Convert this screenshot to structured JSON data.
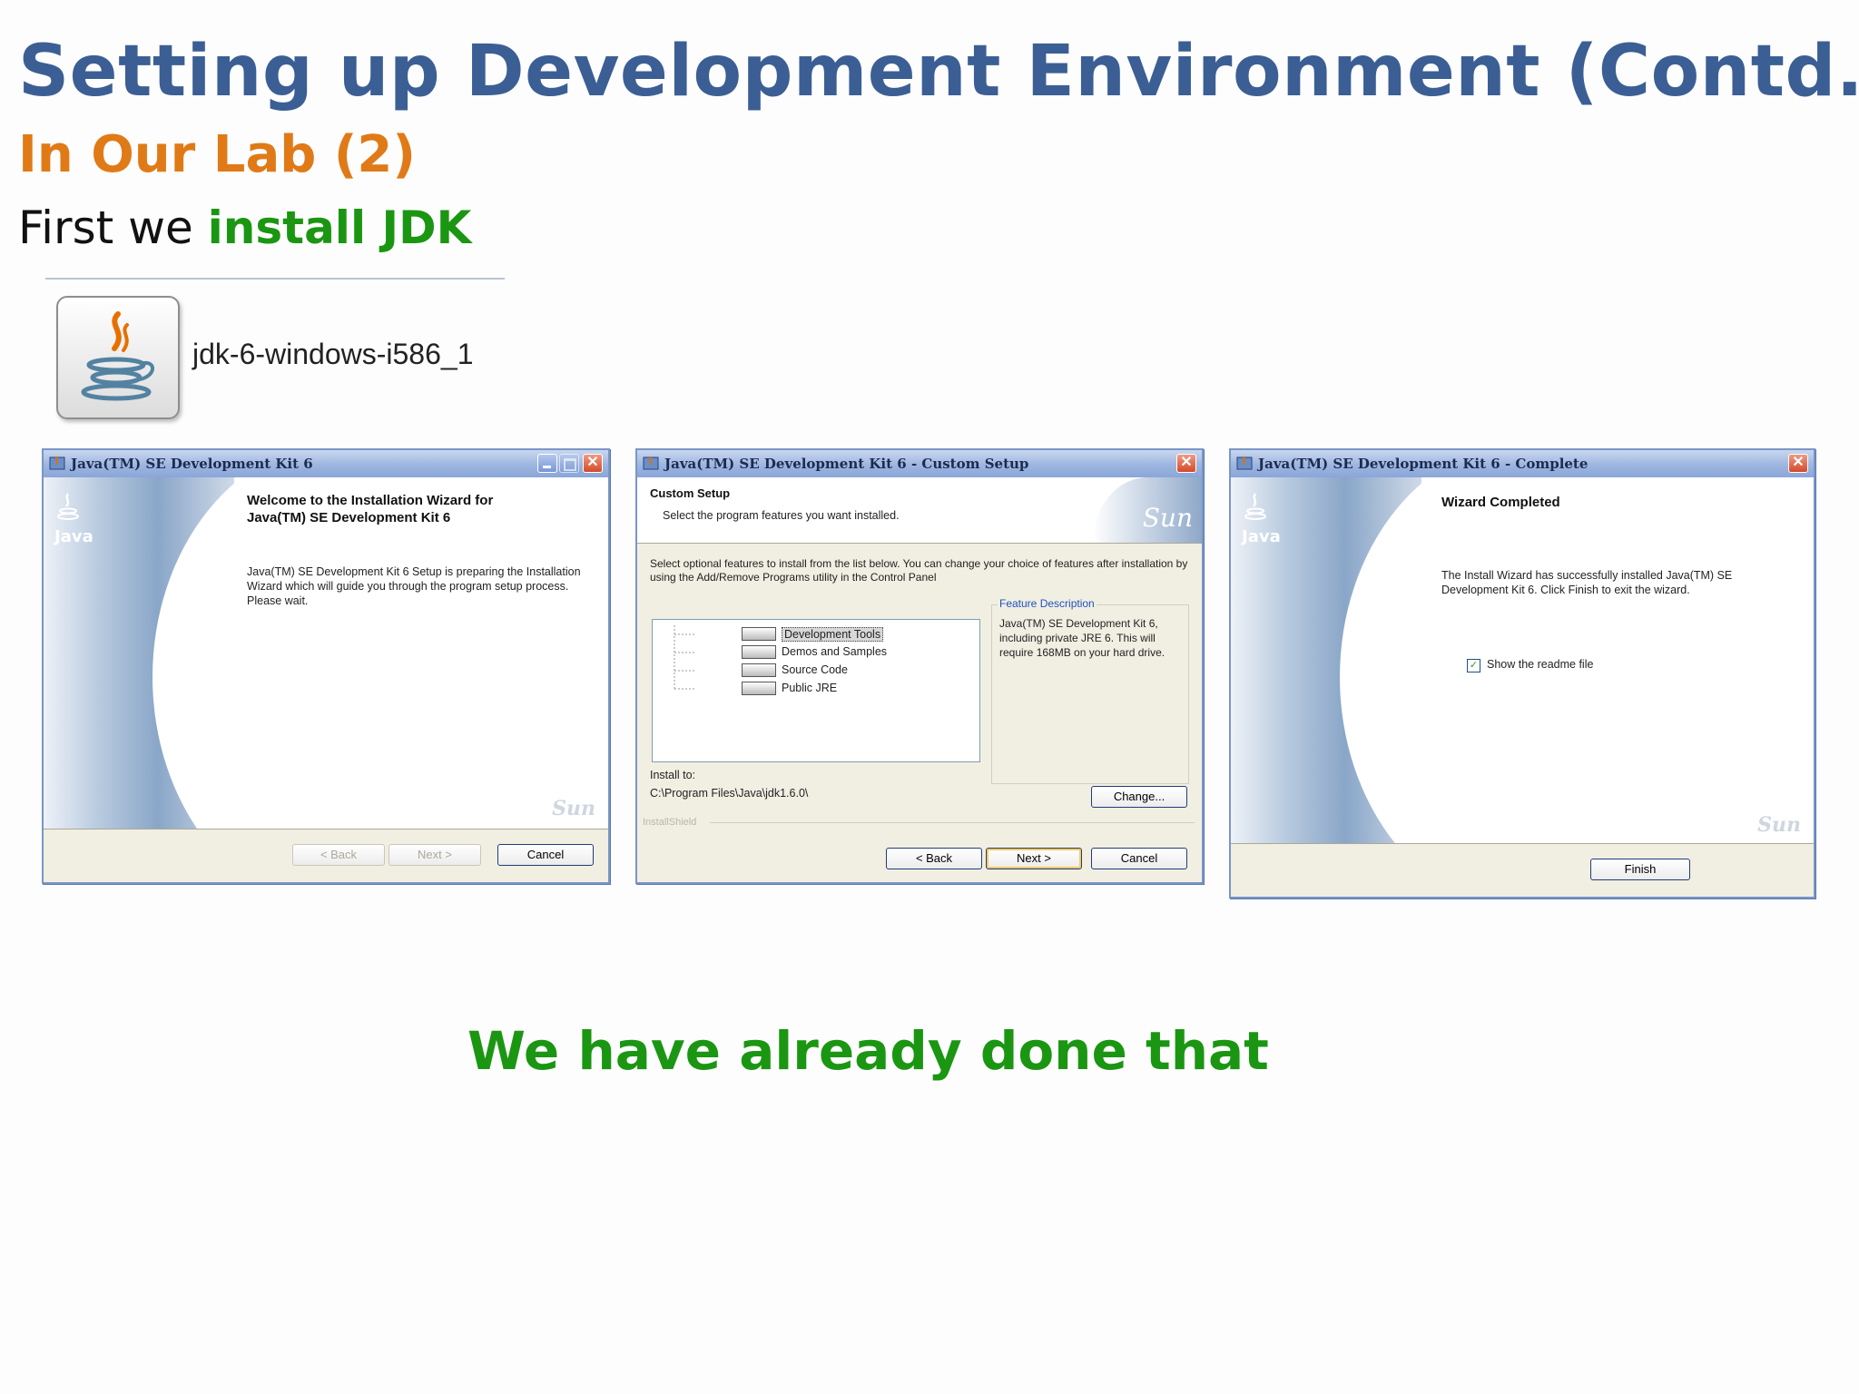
{
  "slide": {
    "title": "Setting up Development Environment (Contd.)",
    "subtitle": "In Our Lab (2)",
    "intro_prefix": "First we ",
    "intro_highlight": "install JDK",
    "footer": "We have already done that"
  },
  "installer_file": {
    "name": "jdk-6-windows-i586_1",
    "icon": "java-cup-icon"
  },
  "windows": {
    "welcome": {
      "title": "Java(TM) SE Development Kit 6",
      "side_label": "Java",
      "heading": "Welcome to the Installation Wizard for Java(TM) SE Development Kit 6",
      "body": "Java(TM) SE Development Kit 6 Setup is preparing the Installation Wizard which will guide you through the program setup process.  Please wait.",
      "back": "< Back",
      "next": "Next >",
      "cancel": "Cancel",
      "watermark": "Sun"
    },
    "custom": {
      "title": "Java(TM) SE Development Kit 6 - Custom Setup",
      "header_title": "Custom Setup",
      "header_desc": "Select the program features you want installed.",
      "logo": "Sun",
      "instructions": "Select optional features to install from the list below.  You can change your choice of features after installation by using the Add/Remove Programs utility in the Control Panel",
      "features": [
        "Development Tools",
        "Demos and Samples",
        "Source Code",
        "Public JRE"
      ],
      "feature_desc_legend": "Feature Description",
      "feature_desc": "Java(TM) SE Development Kit 6, including private JRE 6.  This will require 168MB on your hard drive.",
      "install_to_label": "Install to:",
      "install_path": "C:\\Program Files\\Java\\jdk1.6.0\\",
      "change": "Change...",
      "brand": "InstallShield",
      "back": "< Back",
      "next": "Next >",
      "cancel": "Cancel"
    },
    "complete": {
      "title": "Java(TM) SE Development Kit 6 - Complete",
      "side_label": "Java",
      "heading": "Wizard Completed",
      "body": "The Install Wizard has successfully installed Java(TM) SE Development Kit 6.  Click Finish to exit the wizard.",
      "checkbox_label": "Show the readme file",
      "checkbox_checked": true,
      "finish": "Finish",
      "watermark": "Sun"
    }
  }
}
